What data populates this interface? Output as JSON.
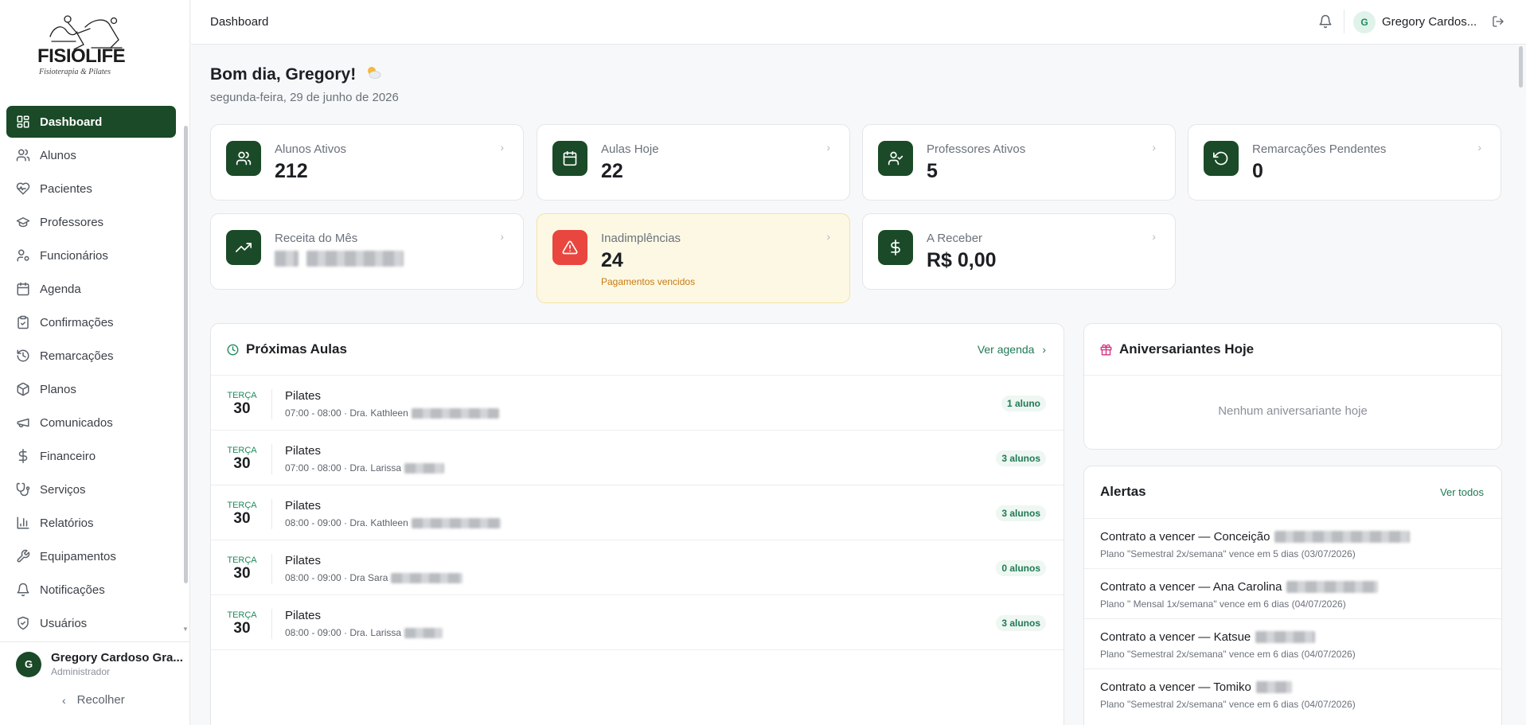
{
  "brand": {
    "name": "FISIOLIFE",
    "tagline": "Fisioterapia & Pilates"
  },
  "sidebar": {
    "items": [
      {
        "label": "Dashboard",
        "icon": "grid-icon",
        "active": true
      },
      {
        "label": "Alunos",
        "icon": "users-icon"
      },
      {
        "label": "Pacientes",
        "icon": "heart-pulse-icon"
      },
      {
        "label": "Professores",
        "icon": "graduation-cap-icon"
      },
      {
        "label": "Funcionários",
        "icon": "user-cog-icon"
      },
      {
        "label": "Agenda",
        "icon": "calendar-icon"
      },
      {
        "label": "Confirmações",
        "icon": "clipboard-check-icon"
      },
      {
        "label": "Remarcações",
        "icon": "history-icon"
      },
      {
        "label": "Planos",
        "icon": "package-icon"
      },
      {
        "label": "Comunicados",
        "icon": "megaphone-icon"
      },
      {
        "label": "Financeiro",
        "icon": "dollar-icon"
      },
      {
        "label": "Serviços",
        "icon": "stethoscope-icon"
      },
      {
        "label": "Relatórios",
        "icon": "bar-chart-icon"
      },
      {
        "label": "Equipamentos",
        "icon": "wrench-icon"
      },
      {
        "label": "Notificações",
        "icon": "bell-icon"
      },
      {
        "label": "Usuários",
        "icon": "shield-check-icon"
      }
    ],
    "user": {
      "initial": "G",
      "name": "Gregory Cardoso Gra...",
      "role": "Administrador"
    },
    "collapse_label": "Recolher"
  },
  "topbar": {
    "title": "Dashboard",
    "user_initial": "G",
    "user_name": "Gregory Cardos..."
  },
  "greeting": {
    "text": "Bom dia, Gregory!",
    "date": "segunda-feira, 29 de junho de 2026"
  },
  "stats": [
    {
      "label": "Alunos Ativos",
      "value": "212",
      "icon": "users-icon"
    },
    {
      "label": "Aulas Hoje",
      "value": "22",
      "icon": "calendar-icon"
    },
    {
      "label": "Professores Ativos",
      "value": "5",
      "icon": "user-check-icon"
    },
    {
      "label": "Remarcações Pendentes",
      "value": "0",
      "icon": "rotate-ccw-icon"
    },
    {
      "label": "Receita do Mês",
      "value": "",
      "icon": "trending-up-icon"
    },
    {
      "label": "Inadimplências",
      "value": "24",
      "sub": "Pagamentos vencidos",
      "icon": "alert-triangle-icon"
    },
    {
      "label": "A Receber",
      "value": "R$ 0,00",
      "icon": "dollar-icon"
    }
  ],
  "upcoming": {
    "title": "Próximas Aulas",
    "link": "Ver agenda",
    "classes": [
      {
        "day": "TERÇA",
        "date": "30",
        "name": "Pilates",
        "info": "07:00 - 08:00 · Dra. Kathleen",
        "count": "1 aluno"
      },
      {
        "day": "TERÇA",
        "date": "30",
        "name": "Pilates",
        "info": "07:00 - 08:00 · Dra. Larissa",
        "count": "3 alunos"
      },
      {
        "day": "TERÇA",
        "date": "30",
        "name": "Pilates",
        "info": "08:00 - 09:00 · Dra. Kathleen",
        "count": "3 alunos"
      },
      {
        "day": "TERÇA",
        "date": "30",
        "name": "Pilates",
        "info": "08:00 - 09:00 · Dra Sara",
        "count": "0 alunos"
      },
      {
        "day": "TERÇA",
        "date": "30",
        "name": "Pilates",
        "info": "08:00 - 09:00 · Dra. Larissa",
        "count": "3 alunos"
      }
    ]
  },
  "birthdays": {
    "title": "Aniversariantes Hoje",
    "empty": "Nenhum aniversariante hoje"
  },
  "alerts": {
    "title": "Alertas",
    "link": "Ver todos",
    "items": [
      {
        "title": "Contrato a vencer — Conceição",
        "desc": "Plano \"Semestral 2x/semana\" vence em 5 dias (03/07/2026)"
      },
      {
        "title": "Contrato a vencer — Ana Carolina",
        "desc": "Plano \" Mensal 1x/semana\" vence em 6 dias (04/07/2026)"
      },
      {
        "title": "Contrato a vencer — Katsue",
        "desc": "Plano \"Semestral 2x/semana\" vence em 6 dias (04/07/2026)"
      },
      {
        "title": "Contrato a vencer — Tomiko",
        "desc": "Plano \"Semestral 2x/semana\" vence em 6 dias (04/07/2026)"
      }
    ]
  },
  "colors": {
    "primary": "#1a4a27",
    "accent": "#1f8a5b",
    "danger": "#e8463f",
    "warning_bg": "#fdf8e4"
  }
}
